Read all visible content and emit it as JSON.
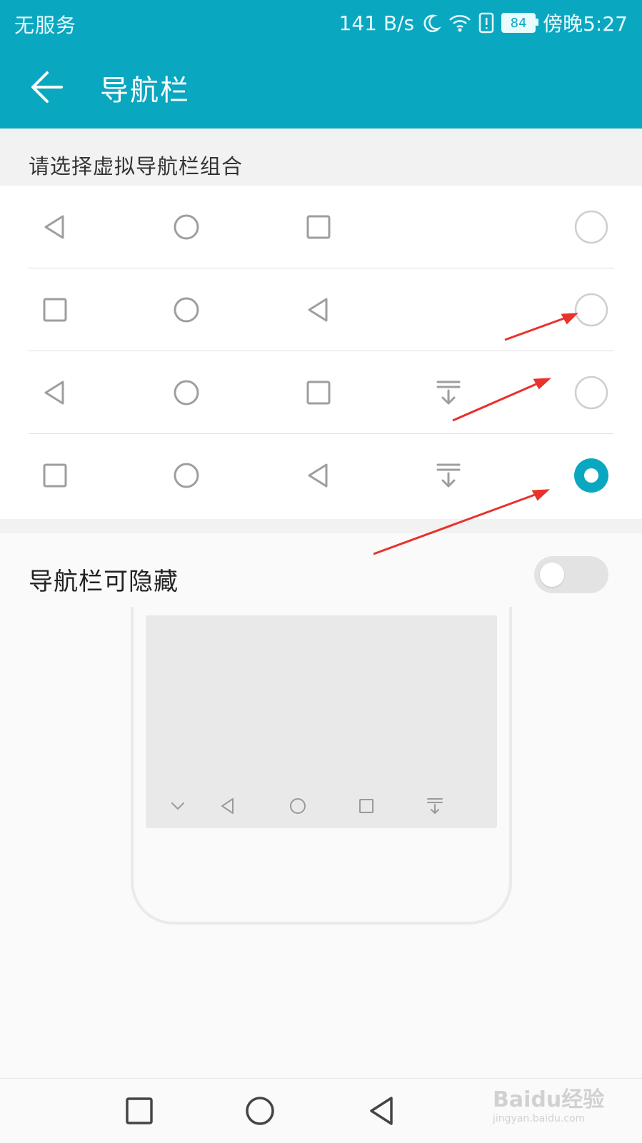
{
  "status_bar": {
    "carrier": "无服务",
    "network_speed": "141 B/s",
    "battery": "84",
    "time": "傍晚5:27"
  },
  "header": {
    "title": "导航栏",
    "back_icon": "arrow-left-icon"
  },
  "section": {
    "title": "请选择虚拟导航栏组合"
  },
  "options": [
    {
      "icons": [
        "back-triangle-icon",
        "home-circle-icon",
        "recent-square-icon"
      ],
      "selected": false
    },
    {
      "icons": [
        "recent-square-icon",
        "home-circle-icon",
        "back-triangle-icon"
      ],
      "selected": false
    },
    {
      "icons": [
        "back-triangle-icon",
        "home-circle-icon",
        "recent-square-icon",
        "notification-pulldown-icon"
      ],
      "selected": false
    },
    {
      "icons": [
        "recent-square-icon",
        "home-circle-icon",
        "back-triangle-icon",
        "notification-pulldown-icon"
      ],
      "selected": true
    }
  ],
  "hide_toggle": {
    "label": "导航栏可隐藏",
    "enabled": false
  },
  "preview": {
    "nav_icons": [
      "chevron-down-icon",
      "back-triangle-icon",
      "home-circle-icon",
      "recent-square-icon",
      "notification-pulldown-icon"
    ]
  },
  "system_nav": {
    "icons": [
      "recent-square-icon",
      "home-circle-icon",
      "back-triangle-icon"
    ]
  },
  "watermark": {
    "text": "Baidu经验",
    "url": "jingyan.baidu.com"
  },
  "colors": {
    "accent": "#0aa7c0",
    "annotation_arrow": "#e8322b"
  }
}
